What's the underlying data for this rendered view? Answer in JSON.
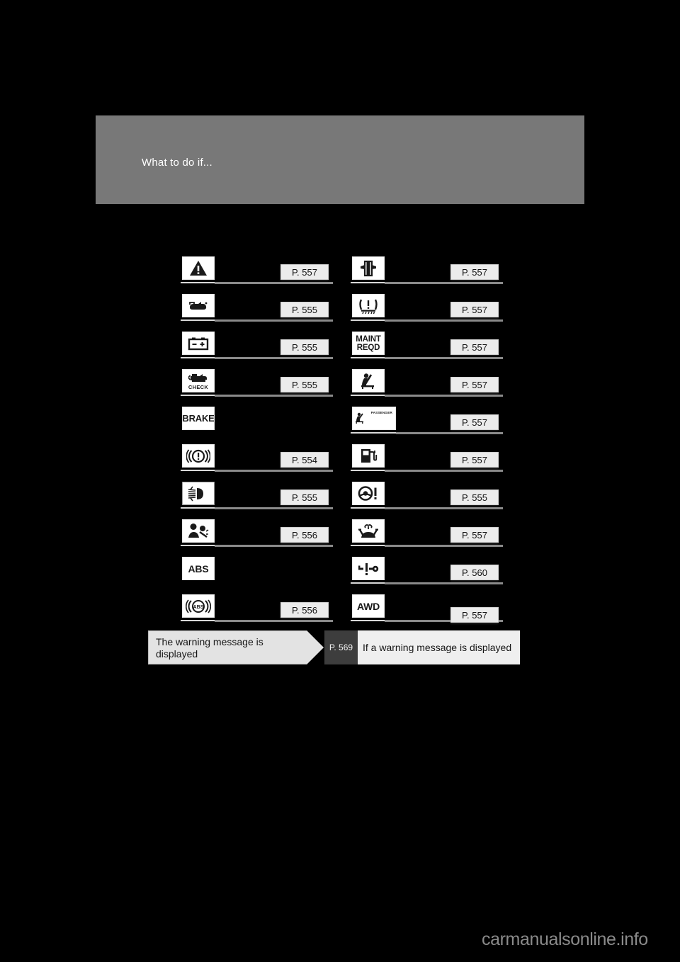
{
  "header": {
    "title": "What to do if...",
    "band_color": "#787878"
  },
  "columns": {
    "left": [
      {
        "icon": "master-warning-triangle-icon",
        "page": "P. 557"
      },
      {
        "icon": "engine-oil-pressure-icon",
        "page": "P. 555"
      },
      {
        "icon": "battery-charge-icon",
        "page": "P. 555"
      },
      {
        "icon": "check-engine-icon",
        "label": "CHECK",
        "page": "P. 555"
      },
      {
        "icon": "brake-system-icon",
        "label": "BRAKE",
        "page": ""
      },
      {
        "icon": "brake-warning-circle-icon",
        "page": "P. 554"
      },
      {
        "icon": "headlight-beam-icon",
        "page": "P. 555"
      },
      {
        "icon": "srs-airbag-icon",
        "page": "P. 556"
      },
      {
        "icon": "abs-icon",
        "label": "ABS",
        "page": ""
      },
      {
        "icon": "abs-circle-icon",
        "label": "ABS",
        "page": "P. 556"
      }
    ],
    "right": [
      {
        "icon": "door-ajar-icon",
        "page": "P. 557"
      },
      {
        "icon": "tire-pressure-icon",
        "page": "P. 557"
      },
      {
        "icon": "maintenance-required-icon",
        "label": "MAINT REQD",
        "page": "P. 557"
      },
      {
        "icon": "seat-belt-reminder-icon",
        "page": "P. 557"
      },
      {
        "icon": "passenger-airbag-icon",
        "label": "PASSENGER",
        "page": "P. 557"
      },
      {
        "icon": "low-fuel-icon",
        "page": "P. 557"
      },
      {
        "icon": "power-steering-icon",
        "page": "P. 555"
      },
      {
        "icon": "washer-fluid-icon",
        "page": "P. 557"
      },
      {
        "icon": "key-immobilizer-icon",
        "page": "P. 560"
      },
      {
        "icon": "awd-icon",
        "label": "AWD",
        "page": "P. 557"
      }
    ]
  },
  "banner": {
    "condition": "The warning message is displayed",
    "page": "P. 569",
    "description": "If a warning message is displayed"
  },
  "watermark": "carmanualsonline.info"
}
